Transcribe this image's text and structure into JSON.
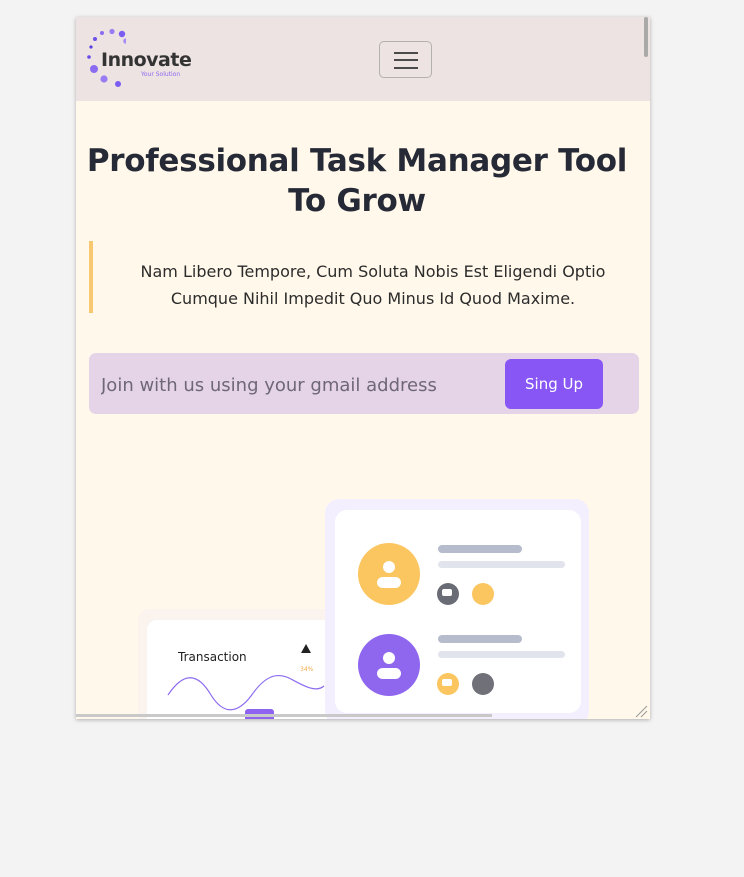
{
  "brand": {
    "name": "Innovate",
    "tagline": "Your Solution",
    "accent": "#8856f4"
  },
  "navbar": {
    "toggler_icon": "hamburger-menu-icon"
  },
  "hero": {
    "title": "Professional Task Manager Tool To Grow",
    "quote": "Nam Libero Tempore, Cum Soluta Nobis Est Eligendi Optio Cumque Nihil Impedit Quo Minus Id Quod Maxime."
  },
  "signup": {
    "placeholder": "Join with us using your gmail address",
    "button_label": "Sing Up"
  },
  "illustration": {
    "transaction_label": "Transaction",
    "transaction_change": "34%",
    "chat_icon": "chat-bubble-icon",
    "user_icon": "user-icon"
  },
  "colors": {
    "page_bg": "#fff8eb",
    "navbar_bg": "#ede3e2",
    "signup_bg": "#e5d4e8",
    "quote_border": "#f7c870",
    "avatar_orange": "#fbc560",
    "avatar_purple": "#8f67ef"
  }
}
